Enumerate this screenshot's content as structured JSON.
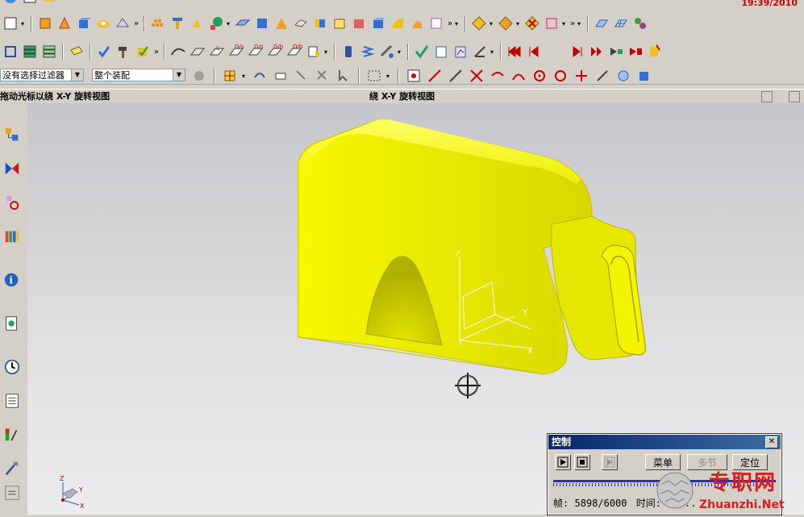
{
  "toolbar1": {
    "clock": "19:39/2010"
  },
  "filters": {
    "selection_filter": "没有选择过滤器",
    "assembly_scope": "整个装配"
  },
  "status": {
    "left_prompt": "拖动光标以绕 X-Y 旋转视图",
    "right_prompt": "绕 X-Y 旋转视图"
  },
  "model": {
    "color": "#f2f200",
    "shadow": "#b8b800"
  },
  "triad": {
    "x": "X",
    "y": "Y",
    "z": "Z"
  },
  "corner_triad": {
    "x": "X",
    "y": "Y",
    "z": "Z"
  },
  "control_dialog": {
    "title": "控制",
    "close": "✕",
    "menu_label": "菜单",
    "multi_label": "多节",
    "locate_label": "定位",
    "frame_label": "帧:",
    "frame_value": "5898/6000",
    "time_label": "时间:",
    "time_value": "20..."
  },
  "watermark": {
    "text": "专职网",
    "url": "Zhuanzhi.Net"
  },
  "colors": {
    "accent": "#0a246a",
    "titlebar_end": "#3a6ea5",
    "watermark_red": "#d81e1e"
  }
}
